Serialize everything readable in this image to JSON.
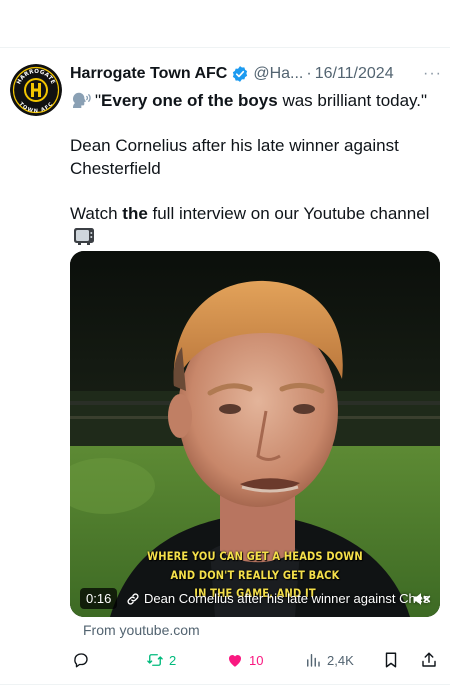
{
  "tweet": {
    "display_name": "Harrogate Town AFC",
    "handle": "@Ha...",
    "separator": "·",
    "date": "16/11/2024",
    "more_label": "···",
    "line1_open": "\"",
    "line1_bold": "Every one of the boys",
    "line1_rest": " was brilliant today.\"",
    "line2": "Dean Cornelius after his late winner against Chesterfield",
    "line3_pre": "Watch ",
    "line3_bold": "the",
    "line3_post": " full interview on our Youtube channel",
    "avatar": {
      "top_text": "HARROGATE",
      "bottom_text": "TOWN AFC",
      "colors": {
        "black": "#111111",
        "gold": "#f2c500"
      }
    }
  },
  "media": {
    "caption_lines": [
      "WHERE YOU CAN GET A HEADS DOWN",
      "AND DON'T REALLY GET BACK",
      "IN THE GAME, AND IT"
    ],
    "duration": "0:16",
    "title": "Dean Cornelius after his late winner against Ches",
    "source": "From youtube.com"
  },
  "actions": {
    "reposts": "2",
    "likes": "10",
    "views": "2,4K"
  },
  "colors": {
    "text": "#0f1419",
    "muted": "#536471",
    "verified": "#1d9bf0",
    "repost": "#00ba7c",
    "like": "#f91880",
    "caption": "#f5e04a"
  },
  "icons": [
    "verified-badge-icon",
    "speaking-head-icon",
    "television-icon",
    "link-icon",
    "mute-icon",
    "reply-icon",
    "repost-icon",
    "like-icon",
    "views-icon",
    "bookmark-icon",
    "share-icon"
  ]
}
